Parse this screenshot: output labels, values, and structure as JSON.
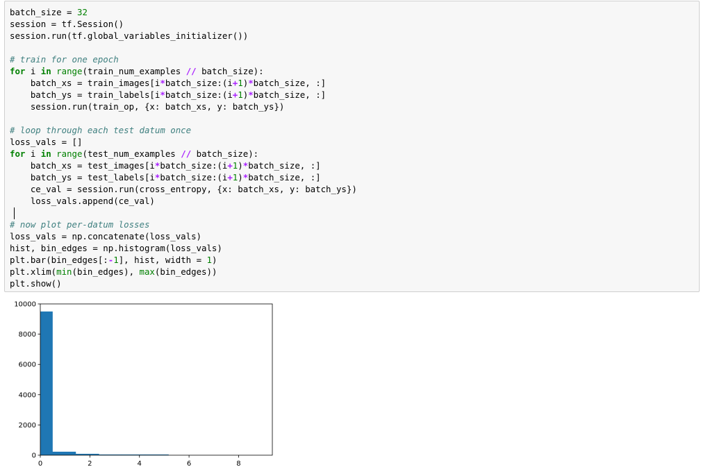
{
  "cell": {
    "lines": [
      [
        {
          "t": "batch_size = "
        },
        {
          "t": "32",
          "c": "num"
        }
      ],
      [
        {
          "t": "session = tf.Session()"
        }
      ],
      [
        {
          "t": "session.run(tf.global_variables_initializer())"
        }
      ],
      [
        {
          "t": ""
        }
      ],
      [
        {
          "t": "# train for one epoch",
          "c": "cm"
        }
      ],
      [
        {
          "t": "for",
          "c": "kw"
        },
        {
          "t": " i "
        },
        {
          "t": "in",
          "c": "kw"
        },
        {
          "t": " "
        },
        {
          "t": "range",
          "c": "bi"
        },
        {
          "t": "(train_num_examples "
        },
        {
          "t": "//",
          "c": "op"
        },
        {
          "t": " batch_size):"
        }
      ],
      [
        {
          "t": "    batch_xs = train_images[i"
        },
        {
          "t": "*",
          "c": "op"
        },
        {
          "t": "batch_size:(i"
        },
        {
          "t": "+",
          "c": "op"
        },
        {
          "t": "1",
          "c": "num"
        },
        {
          "t": ")"
        },
        {
          "t": "*",
          "c": "op"
        },
        {
          "t": "batch_size, :]"
        }
      ],
      [
        {
          "t": "    batch_ys = train_labels[i"
        },
        {
          "t": "*",
          "c": "op"
        },
        {
          "t": "batch_size:(i"
        },
        {
          "t": "+",
          "c": "op"
        },
        {
          "t": "1",
          "c": "num"
        },
        {
          "t": ")"
        },
        {
          "t": "*",
          "c": "op"
        },
        {
          "t": "batch_size, :]"
        }
      ],
      [
        {
          "t": "    session.run(train_op, {x: batch_xs, y: batch_ys})"
        }
      ],
      [
        {
          "t": ""
        }
      ],
      [
        {
          "t": "# loop through each test datum once",
          "c": "cm"
        }
      ],
      [
        {
          "t": "loss_vals = []"
        }
      ],
      [
        {
          "t": "for",
          "c": "kw"
        },
        {
          "t": " i "
        },
        {
          "t": "in",
          "c": "kw"
        },
        {
          "t": " "
        },
        {
          "t": "range",
          "c": "bi"
        },
        {
          "t": "(test_num_examples "
        },
        {
          "t": "//",
          "c": "op"
        },
        {
          "t": " batch_size):"
        }
      ],
      [
        {
          "t": "    batch_xs = test_images[i"
        },
        {
          "t": "*",
          "c": "op"
        },
        {
          "t": "batch_size:(i"
        },
        {
          "t": "+",
          "c": "op"
        },
        {
          "t": "1",
          "c": "num"
        },
        {
          "t": ")"
        },
        {
          "t": "*",
          "c": "op"
        },
        {
          "t": "batch_size, :]"
        }
      ],
      [
        {
          "t": "    batch_ys = test_labels[i"
        },
        {
          "t": "*",
          "c": "op"
        },
        {
          "t": "batch_size:(i"
        },
        {
          "t": "+",
          "c": "op"
        },
        {
          "t": "1",
          "c": "num"
        },
        {
          "t": ")"
        },
        {
          "t": "*",
          "c": "op"
        },
        {
          "t": "batch_size, :]"
        }
      ],
      [
        {
          "t": "    ce_val = session.run(cross_entropy, {x: batch_xs, y: batch_ys})"
        }
      ],
      [
        {
          "t": "    loss_vals.append(ce_val)"
        }
      ],
      [
        {
          "t": ""
        }
      ],
      [
        {
          "t": "# now plot per-datum losses",
          "c": "cm"
        }
      ],
      [
        {
          "t": "loss_vals = np.concatenate(loss_vals)"
        }
      ],
      [
        {
          "t": "hist, bin_edges = np.histogram(loss_vals)"
        }
      ],
      [
        {
          "t": "plt.bar(bin_edges[:"
        },
        {
          "t": "-",
          "c": "op"
        },
        {
          "t": "1",
          "c": "num"
        },
        {
          "t": "], hist, width = "
        },
        {
          "t": "1",
          "c": "num"
        },
        {
          "t": ")"
        }
      ],
      [
        {
          "t": "plt.xlim("
        },
        {
          "t": "min",
          "c": "bi"
        },
        {
          "t": "(bin_edges), "
        },
        {
          "t": "max",
          "c": "bi"
        },
        {
          "t": "(bin_edges))"
        }
      ],
      [
        {
          "t": "plt.show()"
        }
      ]
    ]
  },
  "colors": {
    "bar": "#1f77b4"
  },
  "chart_data": {
    "type": "bar",
    "title": "",
    "xlabel": "",
    "ylabel": "",
    "bin_edges": [
      0,
      0.936,
      1.872,
      2.808,
      3.744,
      4.68,
      5.616,
      6.552,
      7.488,
      8.424,
      9.36
    ],
    "values": [
      9500,
      230,
      90,
      45,
      45,
      45,
      0,
      0,
      0,
      0
    ],
    "bar_width": 1,
    "xlim": [
      0,
      9.36
    ],
    "ylim": [
      0,
      10000
    ],
    "xticks": [
      "0",
      "2",
      "4",
      "6",
      "8"
    ],
    "xtick_values": [
      0,
      2,
      4,
      6,
      8
    ],
    "yticks": [
      "0",
      "2000",
      "4000",
      "6000",
      "8000",
      "10000"
    ],
    "ytick_values": [
      0,
      2000,
      4000,
      6000,
      8000,
      10000
    ],
    "grid": false,
    "legend": "none"
  }
}
